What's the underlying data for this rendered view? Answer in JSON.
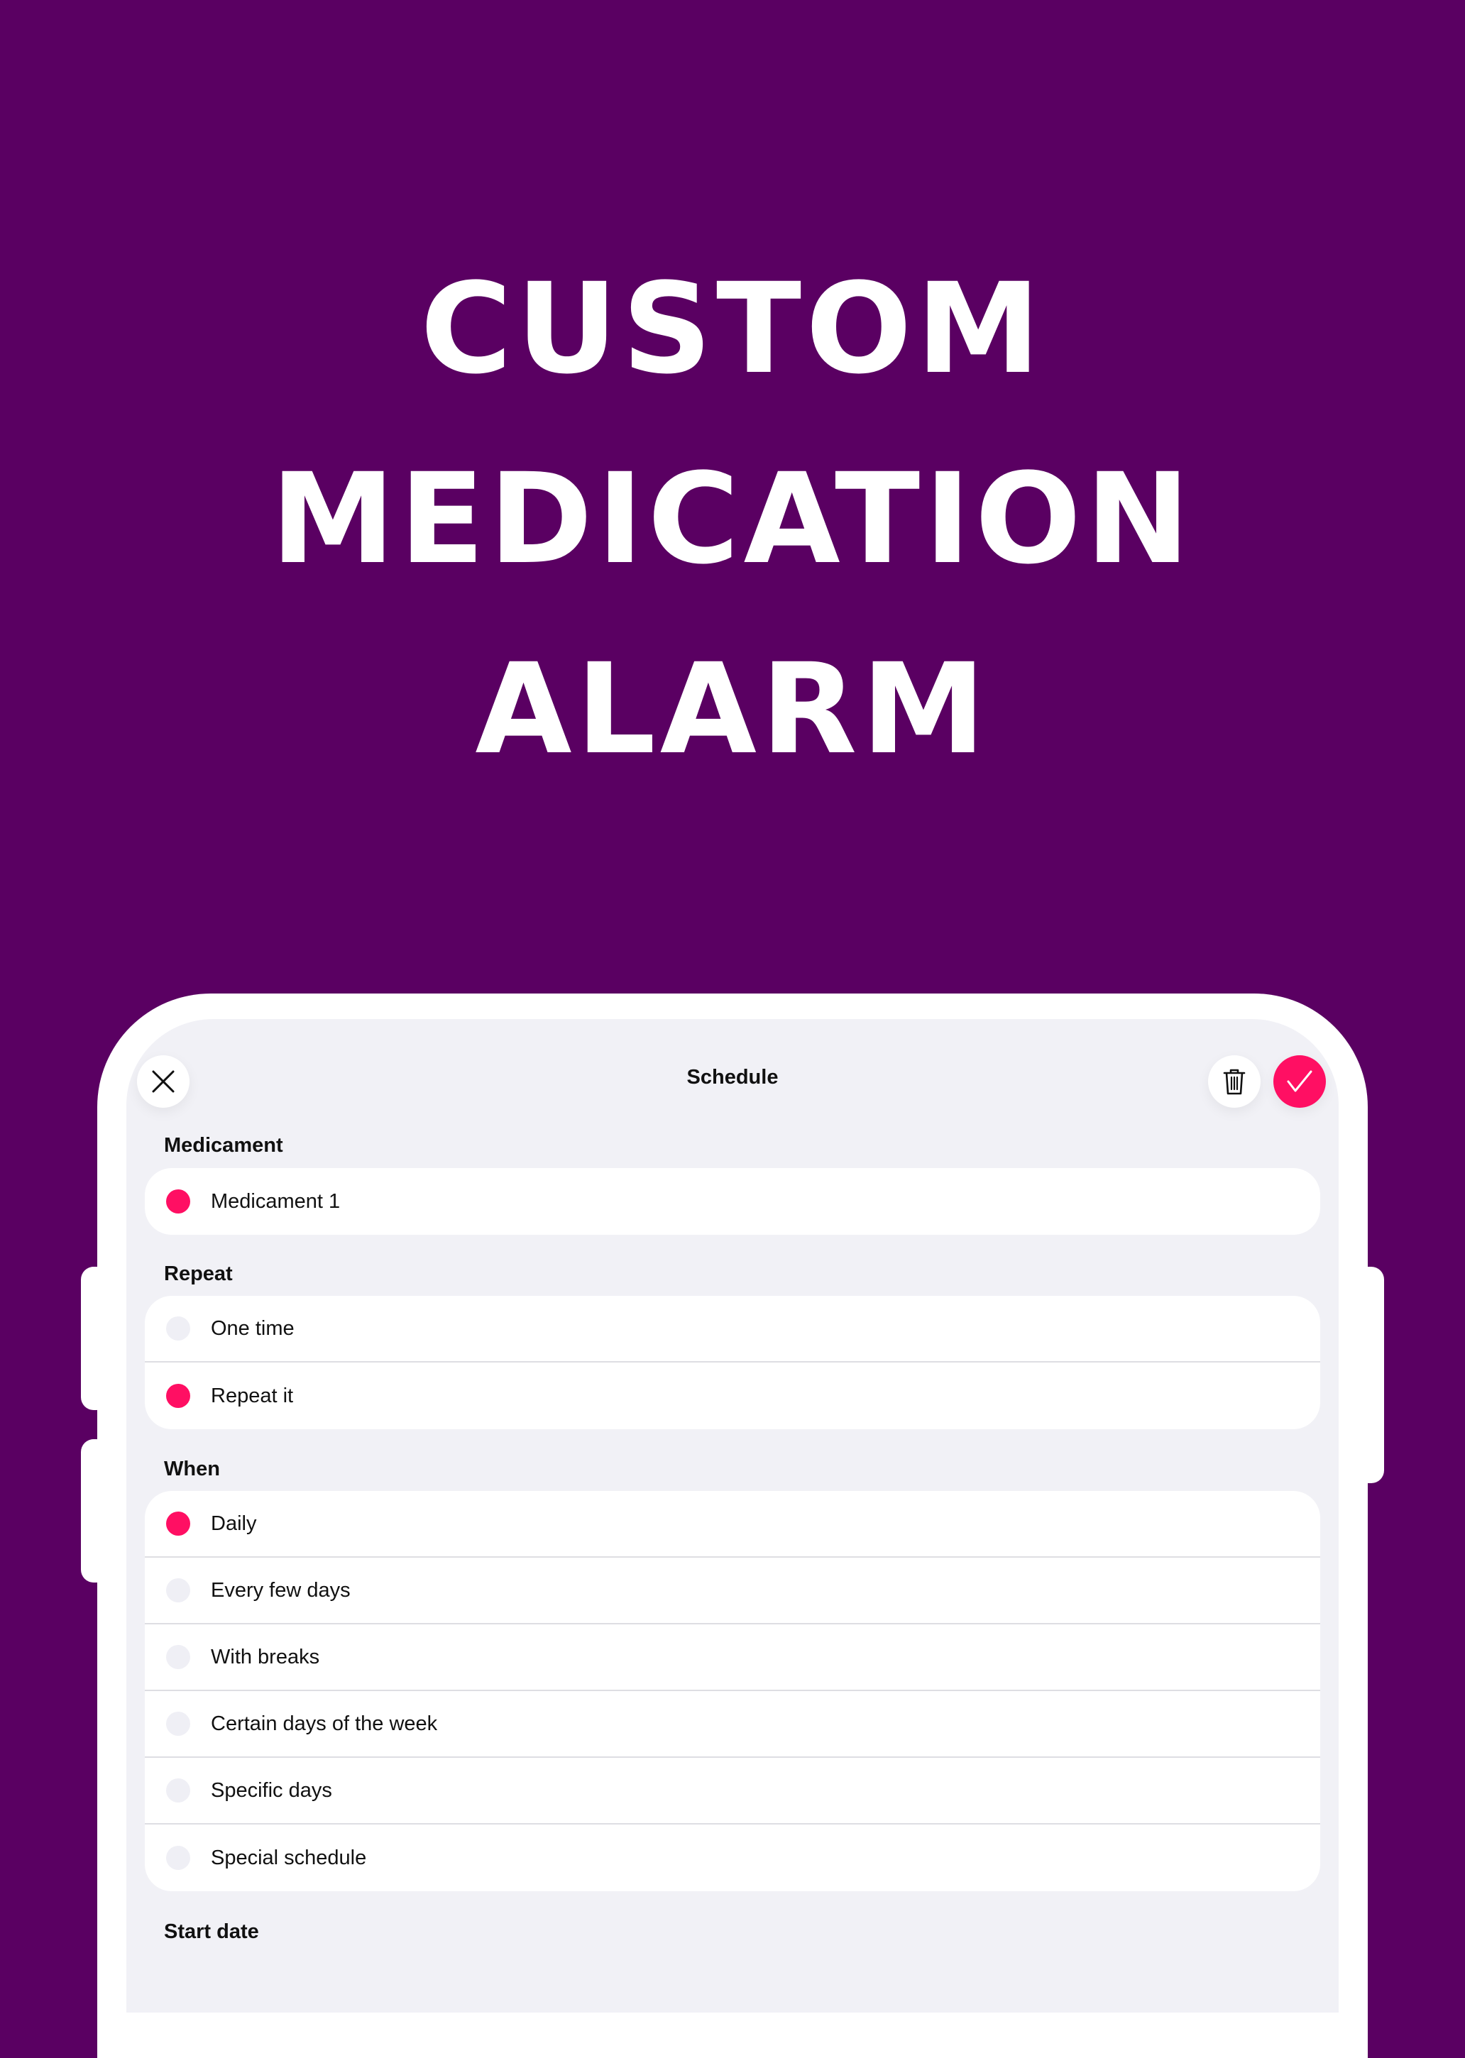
{
  "headline": {
    "line1": "CUSTOM",
    "line2": "MEDICATION",
    "line3": "ALARM"
  },
  "colors": {
    "background": "#5a0062",
    "accent": "#ff0f63",
    "screen": "#f1f1f6"
  },
  "header": {
    "title": "Schedule",
    "close_icon": "close-icon",
    "trash_icon": "trash-icon",
    "confirm_icon": "checkmark-icon"
  },
  "medicament": {
    "label": "Medicament",
    "items": [
      {
        "label": "Medicament 1",
        "selected": true
      }
    ]
  },
  "repeat": {
    "label": "Repeat",
    "items": [
      {
        "label": "One time",
        "selected": false
      },
      {
        "label": "Repeat it",
        "selected": true
      }
    ]
  },
  "when": {
    "label": "When",
    "items": [
      {
        "label": "Daily",
        "selected": true
      },
      {
        "label": "Every few days",
        "selected": false
      },
      {
        "label": "With breaks",
        "selected": false
      },
      {
        "label": "Certain days of the week",
        "selected": false
      },
      {
        "label": "Specific days",
        "selected": false
      },
      {
        "label": "Special schedule",
        "selected": false
      }
    ]
  },
  "start_date": {
    "label": "Start date"
  }
}
